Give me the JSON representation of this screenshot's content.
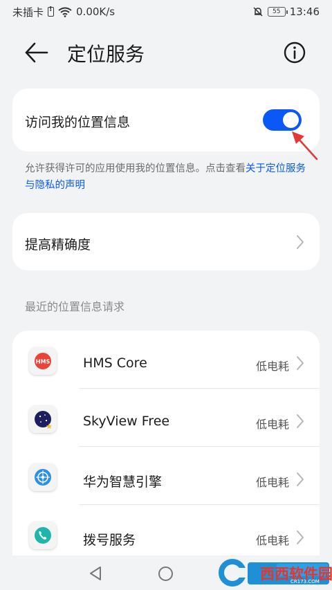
{
  "status_bar": {
    "carrier": "未插卡",
    "speed": "0.00K/s",
    "battery": "55",
    "time": "13:46"
  },
  "header": {
    "title": "定位服务"
  },
  "location_access": {
    "label": "访问我的位置信息",
    "enabled": true,
    "accent_color": "#0a59f7",
    "annotation_color": "#e53935"
  },
  "description": {
    "text": "允许获得许可的应用使用我的位置信息。点击查看",
    "link": "关于定位服务与隐私的声明"
  },
  "accuracy": {
    "label": "提高精确度"
  },
  "recent_requests": {
    "title": "最近的位置信息请求",
    "apps": [
      {
        "name": "HMS Core",
        "status": "低电耗",
        "icon": "hms-core-icon"
      },
      {
        "name": "SkyView Free",
        "status": "低电耗",
        "icon": "skyview-icon"
      },
      {
        "name": "华为智慧引擎",
        "status": "低电耗",
        "icon": "huawei-smart-engine-icon"
      },
      {
        "name": "拨号服务",
        "status": "低电耗",
        "icon": "dialer-service-icon"
      }
    ]
  },
  "watermark": {
    "brand": "西西软件园",
    "site": "CR173.COM"
  }
}
